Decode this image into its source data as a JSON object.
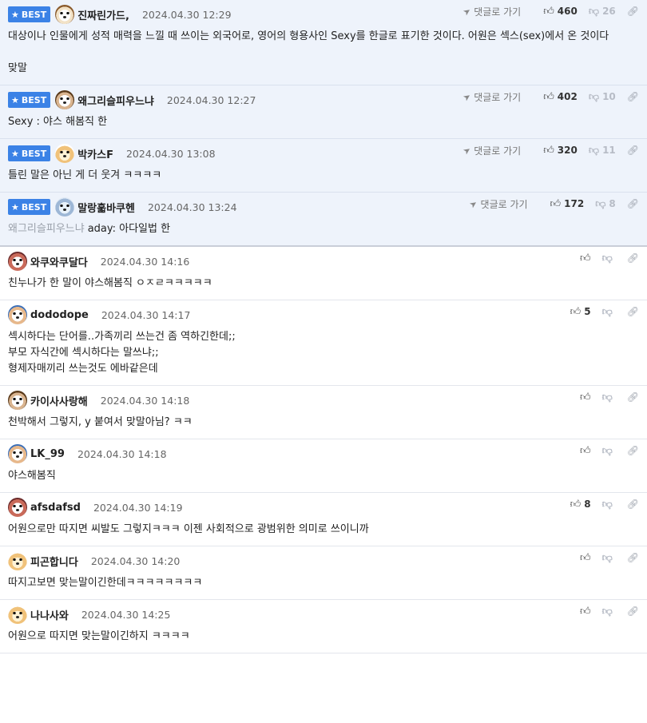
{
  "labels": {
    "best": "BEST",
    "reply": "댓글로 가기"
  },
  "icons": {
    "best_star": "star-icon",
    "reply": "send-arrow-icon",
    "up": "thumbs-up-icon",
    "down": "thumbs-down-icon",
    "link": "link-icon"
  },
  "comments": [
    {
      "best": true,
      "nick": "진짜린가드,",
      "date": "2024.04.30 12:29",
      "up": "460",
      "down": "26",
      "lines": [
        "대상이나 인물에게 성적 매력을 느낄 때 쓰이는 외국어로, 영어의 형용사인 Sexy를 한글로 표기한 것이다. 어원은 섹스(sex)에서 온 것이다",
        "",
        "맞말"
      ]
    },
    {
      "best": true,
      "nick": "왜그리슬피우느냐",
      "date": "2024.04.30 12:27",
      "up": "402",
      "down": "10",
      "lines": [
        "Sexy : 야스 해봄직 한"
      ]
    },
    {
      "best": true,
      "nick": "박카스F",
      "date": "2024.04.30 13:08",
      "up": "320",
      "down": "11",
      "lines": [
        "틀린 말은 아닌 게 더 웃겨 ㅋㅋㅋㅋ"
      ]
    },
    {
      "best": true,
      "nick": "말랑훏바쿠헨",
      "date": "2024.04.30 13:24",
      "up": "172",
      "down": "8",
      "mention": "왜그리슬피우느냐",
      "lines": [
        "aday: 아다일법 한"
      ]
    },
    {
      "best": false,
      "nick": "와쿠와쿠달다",
      "date": "2024.04.30 14:16",
      "up": "",
      "lines": [
        "친누나가 한 말이 야스해봄직 ㅇㅈㄹㅋㅋㅋㅋㅋ"
      ]
    },
    {
      "best": false,
      "nick": "dododope",
      "date": "2024.04.30 14:17",
      "up": "5",
      "lines": [
        "섹시하다는 단어를..가족끼리 쓰는건 좀 역하긴한데;;",
        "부모 자식간에 섹시하다는 말쓰냐;;",
        "형제자매끼리 쓰는것도 에바같은데"
      ]
    },
    {
      "best": false,
      "nick": "카이사사랑해",
      "date": "2024.04.30 14:18",
      "up": "",
      "lines": [
        "천박해서 그렇지, y 붙여서 맞말아님? ㅋㅋ"
      ]
    },
    {
      "best": false,
      "nick": "LK_99",
      "date": "2024.04.30 14:18",
      "up": "",
      "lines": [
        "야스해봄직"
      ]
    },
    {
      "best": false,
      "nick": "afsdafsd",
      "date": "2024.04.30 14:19",
      "up": "8",
      "lines": [
        "어원으로만 따지면 씨발도 그렇지ㅋㅋㅋ 이젠 사회적으로 광범위한 의미로 쓰이니까"
      ]
    },
    {
      "best": false,
      "nick": "피곤합니다",
      "date": "2024.04.30 14:20",
      "up": "",
      "lines": [
        "따지고보면 맞는말이긴한데ㅋㅋㅋㅋㅋㅋㅋㅋ"
      ]
    },
    {
      "best": false,
      "nick": "나나사와",
      "date": "2024.04.30 14:25",
      "up": "",
      "lines": [
        "어원으로 따지면 맞는말이긴하지 ㅋㅋㅋㅋ"
      ]
    }
  ]
}
